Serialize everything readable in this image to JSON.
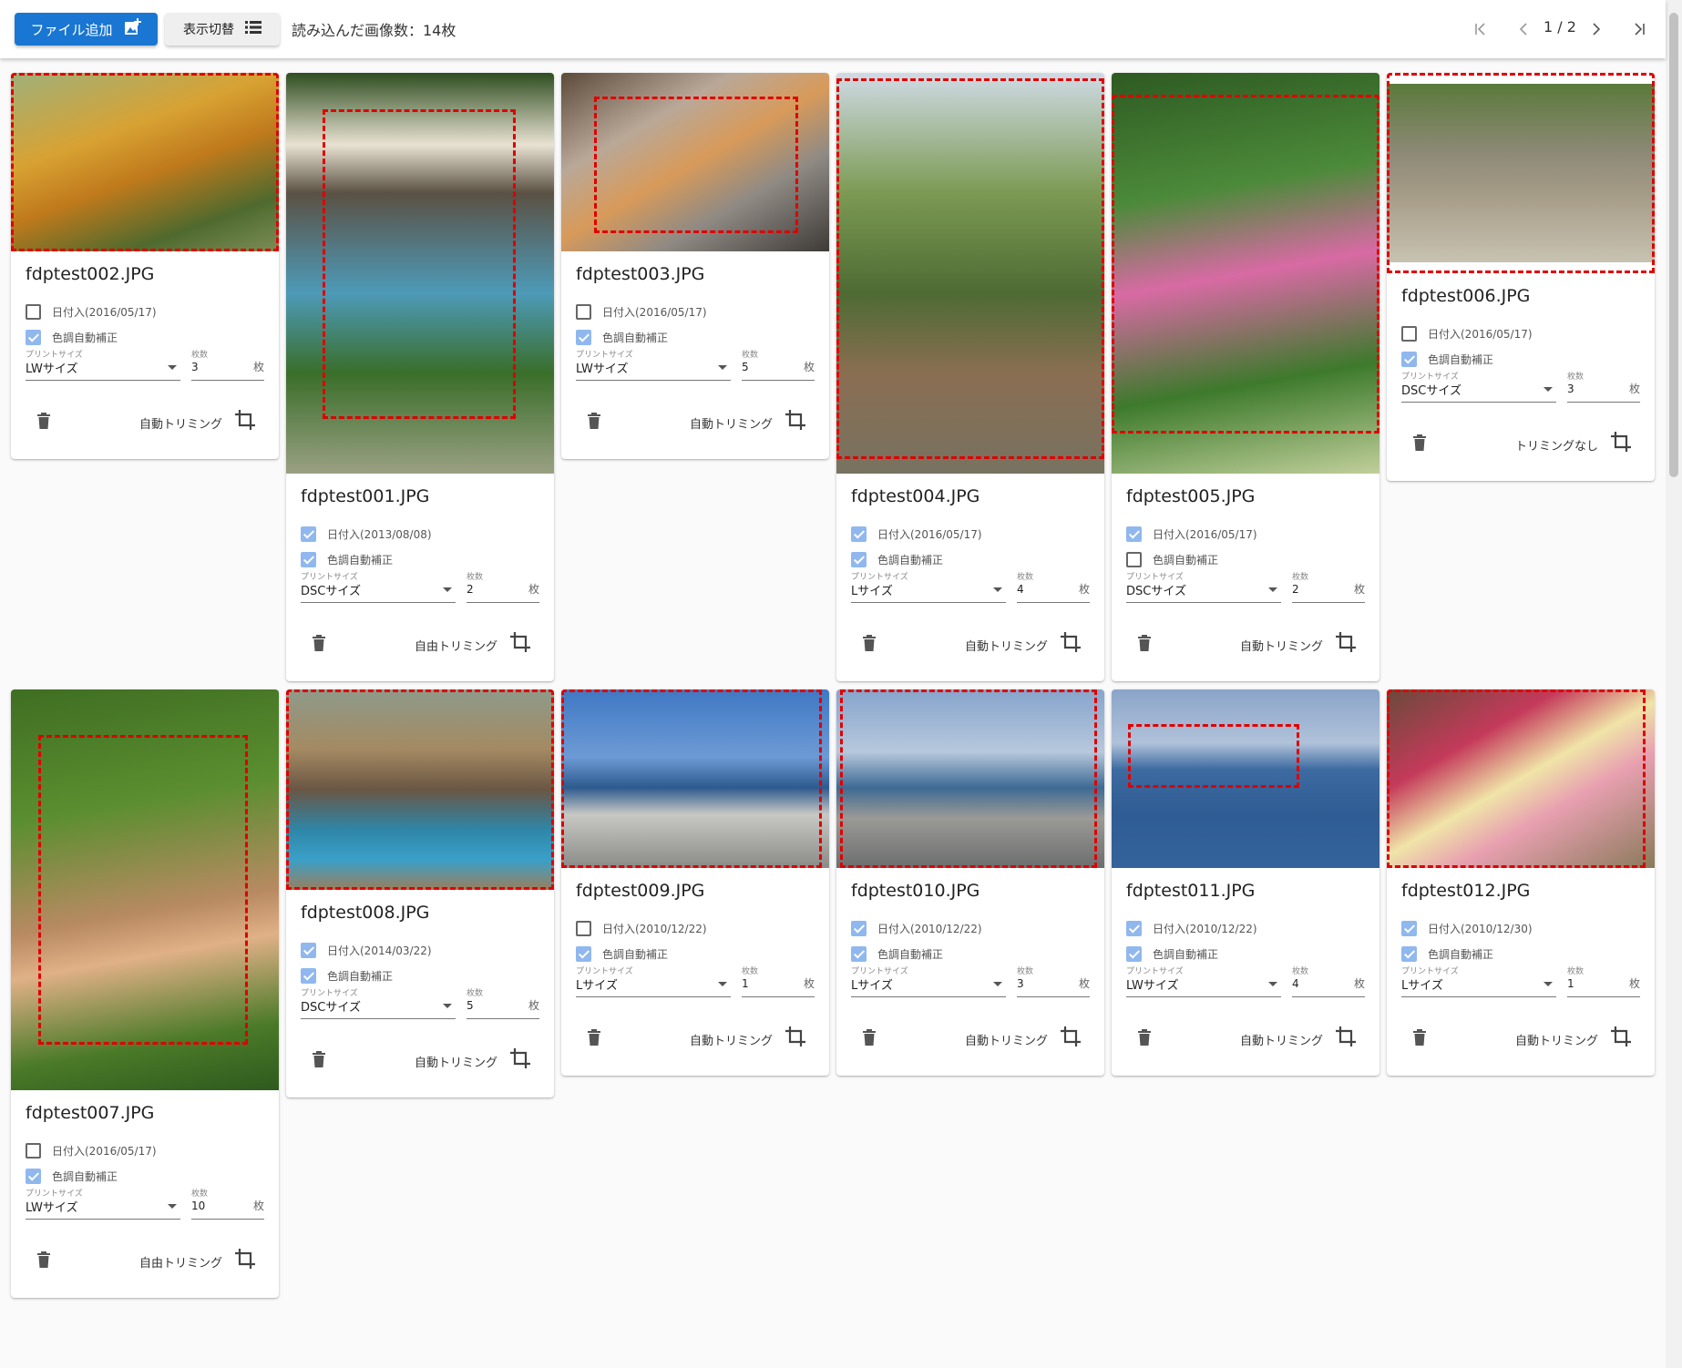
{
  "toolbar": {
    "add_file_label": "ファイル追加",
    "toggle_view_label": "表示切替",
    "loaded_count": "読み込んだ画像数：14枚",
    "page_indicator": "1 / 2"
  },
  "labels": {
    "print_size": "プリントサイズ",
    "quantity": "枚数",
    "unit": "枚"
  },
  "cards": [
    {
      "title": "fdptest002.JPG",
      "date_label": "日付入(2016/05/17)",
      "date_checked": false,
      "color_label": "色調自動補正",
      "color_checked": true,
      "size": "LWサイズ",
      "qty": "3",
      "trim_label": "自動トリミング"
    },
    {
      "title": "fdptest001.JPG",
      "date_label": "日付入(2013/08/08)",
      "date_checked": true,
      "color_label": "色調自動補正",
      "color_checked": true,
      "size": "DSCサイズ",
      "qty": "2",
      "trim_label": "自由トリミング"
    },
    {
      "title": "fdptest003.JPG",
      "date_label": "日付入(2016/05/17)",
      "date_checked": false,
      "color_label": "色調自動補正",
      "color_checked": true,
      "size": "LWサイズ",
      "qty": "5",
      "trim_label": "自動トリミング"
    },
    {
      "title": "fdptest004.JPG",
      "date_label": "日付入(2016/05/17)",
      "date_checked": true,
      "color_label": "色調自動補正",
      "color_checked": true,
      "size": "Lサイズ",
      "qty": "4",
      "trim_label": "自動トリミング"
    },
    {
      "title": "fdptest005.JPG",
      "date_label": "日付入(2016/05/17)",
      "date_checked": true,
      "color_label": "色調自動補正",
      "color_checked": false,
      "size": "DSCサイズ",
      "qty": "2",
      "trim_label": "自動トリミング"
    },
    {
      "title": "fdptest006.JPG",
      "date_label": "日付入(2016/05/17)",
      "date_checked": false,
      "color_label": "色調自動補正",
      "color_checked": true,
      "size": "DSCサイズ",
      "qty": "3",
      "trim_label": "トリミングなし"
    },
    {
      "title": "fdptest007.JPG",
      "date_label": "日付入(2016/05/17)",
      "date_checked": false,
      "color_label": "色調自動補正",
      "color_checked": true,
      "size": "LWサイズ",
      "qty": "10",
      "trim_label": "自由トリミング"
    },
    {
      "title": "fdptest008.JPG",
      "date_label": "日付入(2014/03/22)",
      "date_checked": true,
      "color_label": "色調自動補正",
      "color_checked": true,
      "size": "DSCサイズ",
      "qty": "5",
      "trim_label": "自動トリミング"
    },
    {
      "title": "fdptest009.JPG",
      "date_label": "日付入(2010/12/22)",
      "date_checked": false,
      "color_label": "色調自動補正",
      "color_checked": true,
      "size": "Lサイズ",
      "qty": "1",
      "trim_label": "自動トリミング"
    },
    {
      "title": "fdptest010.JPG",
      "date_label": "日付入(2010/12/22)",
      "date_checked": true,
      "color_label": "色調自動補正",
      "color_checked": true,
      "size": "Lサイズ",
      "qty": "3",
      "trim_label": "自動トリミング"
    },
    {
      "title": "fdptest011.JPG",
      "date_label": "日付入(2010/12/22)",
      "date_checked": true,
      "color_label": "色調自動補正",
      "color_checked": true,
      "size": "LWサイズ",
      "qty": "4",
      "trim_label": "自動トリミング"
    },
    {
      "title": "fdptest012.JPG",
      "date_label": "日付入(2010/12/30)",
      "date_checked": true,
      "color_label": "色調自動補正",
      "color_checked": true,
      "size": "Lサイズ",
      "qty": "1",
      "trim_label": "自動トリミング"
    }
  ],
  "colors": {
    "primary": "#1976d2",
    "crop_outline": "#e00000",
    "checkbox_checked": "#90b8ee"
  }
}
